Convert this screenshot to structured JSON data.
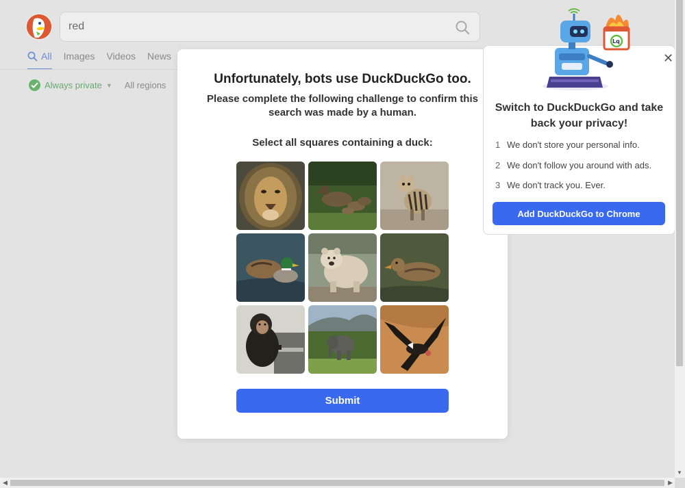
{
  "search": {
    "query": "red"
  },
  "tabs": [
    {
      "label": "All",
      "active": true
    },
    {
      "label": "Images"
    },
    {
      "label": "Videos"
    },
    {
      "label": "News"
    }
  ],
  "filters": {
    "privacy_label": "Always private",
    "region_label": "All regions"
  },
  "challenge": {
    "title": "Unfortunately, bots use DuckDuckGo too.",
    "description": "Please complete the following challenge to confirm this search was made by a human.",
    "instruction": "Select all squares containing a duck:",
    "tiles": [
      {
        "subject": "lion",
        "icon": "lion-icon"
      },
      {
        "subject": "ducks on grass",
        "icon": "duck-icon"
      },
      {
        "subject": "aardwolf cub",
        "icon": "aardwolf-icon"
      },
      {
        "subject": "mallard duck",
        "icon": "duck-icon"
      },
      {
        "subject": "bear",
        "icon": "bear-icon"
      },
      {
        "subject": "female mallard duck",
        "icon": "duck-icon"
      },
      {
        "subject": "chimpanzee",
        "icon": "chimp-icon"
      },
      {
        "subject": "elephant",
        "icon": "elephant-icon"
      },
      {
        "subject": "condor",
        "icon": "condor-icon"
      }
    ],
    "submit_label": "Submit"
  },
  "promo": {
    "close_label": "✕",
    "title": "Switch to DuckDuckGo and take back your privacy!",
    "items": [
      {
        "num": "1",
        "text": "We don't store your personal info."
      },
      {
        "num": "2",
        "text": "We don't follow you around with ads."
      },
      {
        "num": "3",
        "text": "We don't track you. Ever."
      }
    ],
    "cta_label": "Add DuckDuckGo to Chrome"
  },
  "colors": {
    "accent": "#3969ef",
    "brand": "#de5833",
    "privacy_green": "#68b36e",
    "active_tab": "#6a8dd8"
  }
}
